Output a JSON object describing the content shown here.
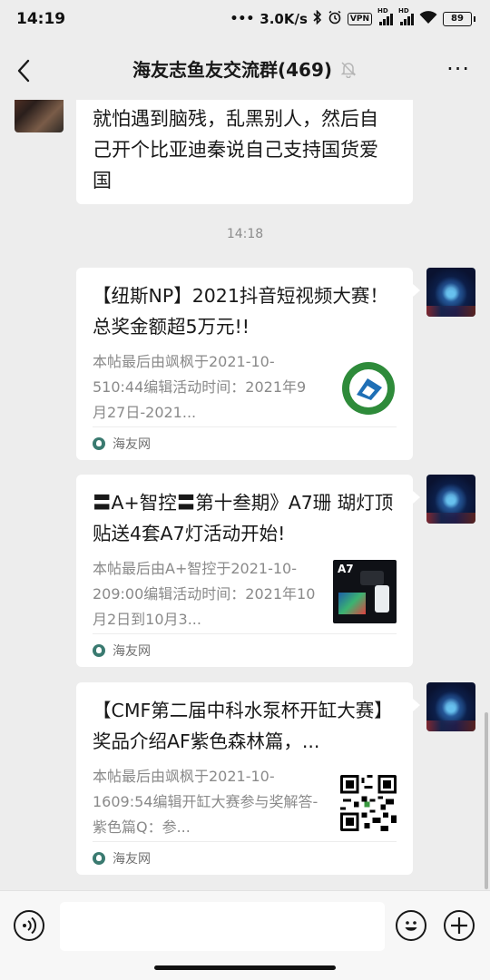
{
  "status": {
    "time": "14:19",
    "speed": "3.0K/s",
    "vpn": "VPN",
    "hd": "HD",
    "battery": "89"
  },
  "header": {
    "title": "海友志鱼友交流群(469)",
    "more": "···"
  },
  "chat": {
    "prev_message": "就怕遇到脑残，乱黑别人，然后自己开个比亚迪秦说自己支持国货爱国",
    "timestamp": "14:18",
    "cards": [
      {
        "title": "【纽斯NP】2021抖音短视频大赛！总奖金额超5万元!!",
        "desc": "本帖最后由飒枫于2021-10-510:44编辑活动时间：2021年9月27日-2021...",
        "source": "海友网",
        "thumb": "logo-badge-icon"
      },
      {
        "title": "〓A+智控〓第十叁期》A7珊 瑚灯顶贴送4套A7灯活动开始!",
        "desc": "本帖最后由A+智控于2021-10-209:00编辑活动时间：2021年10月2日到10月3...",
        "source": "海友网",
        "thumb": "product-photo",
        "thumb_label": "A7"
      },
      {
        "title": "【CMF第二届中科水泵杯开缸大赛】奖品介绍AF紫色森林篇，...",
        "desc": "本帖最后由飒枫于2021-10-1609:54编辑开缸大赛参与奖解答-紫色篇Q：参...",
        "source": "海友网",
        "thumb": "qr-code-icon"
      }
    ]
  },
  "input": {
    "placeholder": ""
  }
}
